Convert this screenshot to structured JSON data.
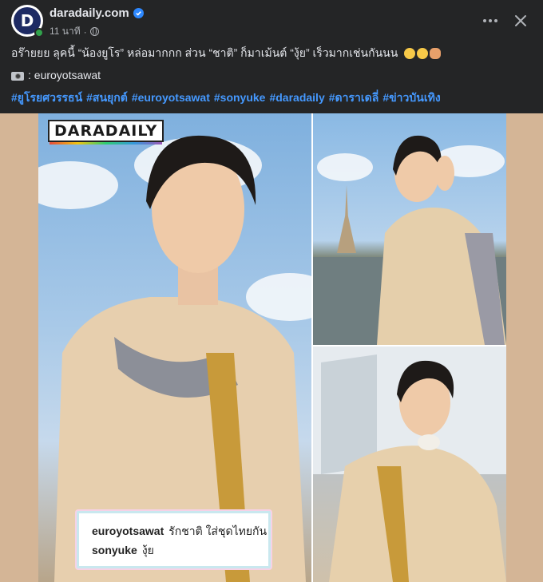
{
  "post": {
    "page_name": "daradaily.com",
    "time": "11 นาที",
    "dot": "·",
    "privacy_icon": "globe-icon",
    "avatar_letter": "D",
    "verified_icon": "verified-badge-icon",
    "more_icon": "more-horizontal-icon",
    "close_icon": "close-icon"
  },
  "text": {
    "line1": "อร๊ายยย ลุคนี้ “น้องยูโร” หล่อมากกก ส่วน “ชาติ” ก็มาเม้นต์ “งุ้ย” เร็วมากเช่นกันนน",
    "emojis": [
      "shushing-face",
      "rolling-laughing-face",
      "pointing-hand"
    ],
    "credit": ": euroyotsawat",
    "camera_icon": "camera-icon",
    "hashtags": [
      "#ยูโรยศวรรธน์",
      "#สนยุกต์",
      "#euroyotsawat",
      "#sonyuke",
      "#daradaily",
      "#ดาราเดลี่",
      "#ข่าวบันเทิง"
    ]
  },
  "media": {
    "logo": "DARADAILY",
    "comment": {
      "user1": "euroyotsawat",
      "text1": "รักชาติ ใส่ชุดไทยกัน",
      "user2": "sonyuke",
      "text2": "งุ้ย"
    }
  },
  "colors": {
    "background": "#242526",
    "hashtag": "#4599ff",
    "verified": "#2d88ff",
    "media_bg": "#d4b596"
  }
}
